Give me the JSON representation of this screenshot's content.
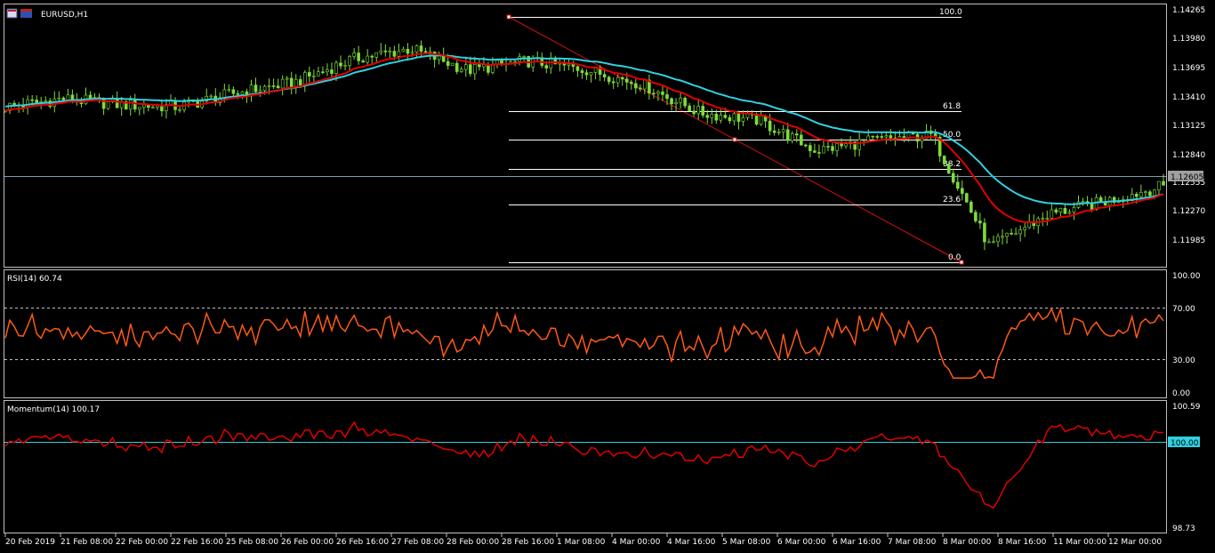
{
  "window": {
    "symbol_title": "EURUSD,H1",
    "icon": "chart-window-icon"
  },
  "colors": {
    "background": "#000000",
    "grid_border": "#c0c0c0",
    "bull_candle": "#7fdc3c",
    "ma_fast": "#e00000",
    "ma_slow": "#30d0e0",
    "rsi_line": "#ff5a14",
    "momentum_line": "#e00000",
    "fib_lines": "#ffffff",
    "fib_trend": "#d01010",
    "price_line": "#70a0b0",
    "reference_line": "#30d0e0"
  },
  "main_panel": {
    "price_ticks": [
      "1.14265",
      "1.13980",
      "1.13695",
      "1.13410",
      "1.13125",
      "1.12840",
      "1.12555",
      "1.12270",
      "1.11985"
    ],
    "current_price": "1.12605",
    "fib_levels": [
      "100.0",
      "61.8",
      "50.0",
      "38.2",
      "23.6",
      "0.0"
    ]
  },
  "rsi_panel": {
    "title": "RSI(14) 60.74",
    "ticks": [
      "100.00",
      "70.00",
      "30.00",
      "0.00"
    ]
  },
  "momentum_panel": {
    "title": "Momentum(14) 100.17",
    "ticks": [
      "100.59",
      "98.73"
    ],
    "reference_value": "100.00"
  },
  "time_axis": {
    "labels": [
      "20 Feb 2019",
      "21 Feb 08:00",
      "22 Feb 00:00",
      "22 Feb 16:00",
      "25 Feb 08:00",
      "26 Feb 00:00",
      "26 Feb 16:00",
      "27 Feb 08:00",
      "28 Feb 00:00",
      "28 Feb 16:00",
      "1 Mar 08:00",
      "4 Mar 00:00",
      "4 Mar 16:00",
      "5 Mar 08:00",
      "6 Mar 00:00",
      "6 Mar 16:00",
      "7 Mar 08:00",
      "8 Mar 00:00",
      "8 Mar 16:00",
      "11 Mar 00:00",
      "12 Mar 00:00"
    ]
  },
  "chart_data": {
    "type": "line",
    "symbol": "EURUSD",
    "timeframe": "H1",
    "price_key_points": [
      {
        "t": "20 Feb 2019",
        "price": 1.1338
      },
      {
        "t": "21 Feb 08:00",
        "price": 1.1346
      },
      {
        "t": "22 Feb 00:00",
        "price": 1.134
      },
      {
        "t": "22 Feb 16:00",
        "price": 1.1338
      },
      {
        "t": "25 Feb 08:00",
        "price": 1.1352
      },
      {
        "t": "26 Feb 00:00",
        "price": 1.1362
      },
      {
        "t": "26 Feb 16:00",
        "price": 1.1385
      },
      {
        "t": "27 Feb 08:00",
        "price": 1.1395
      },
      {
        "t": "28 Feb 00:00",
        "price": 1.1374
      },
      {
        "t": "28 Feb 16:00",
        "price": 1.1383
      },
      {
        "t": "1 Mar 08:00",
        "price": 1.1375
      },
      {
        "t": "4 Mar 00:00",
        "price": 1.136
      },
      {
        "t": "4 Mar 16:00",
        "price": 1.1332
      },
      {
        "t": "5 Mar 08:00",
        "price": 1.1325
      },
      {
        "t": "6 Mar 00:00",
        "price": 1.1295
      },
      {
        "t": "6 Mar 16:00",
        "price": 1.1305
      },
      {
        "t": "7 Mar 08:00",
        "price": 1.131
      },
      {
        "t": "8 Mar 00:00",
        "price": 1.12
      },
      {
        "t": "8 Mar 16:00",
        "price": 1.1232
      },
      {
        "t": "11 Mar 00:00",
        "price": 1.1245
      },
      {
        "t": "12 Mar 00:00",
        "price": 1.126
      }
    ],
    "fibonacci": {
      "high": 1.14265,
      "low": 1.1185,
      "levels": [
        100.0,
        61.8,
        50.0,
        38.2,
        23.6,
        0.0
      ]
    },
    "rsi": {
      "ylim": [
        0,
        100
      ],
      "levels": [
        70,
        30
      ],
      "last": 60.74
    },
    "momentum": {
      "ylim": [
        98.73,
        100.59
      ],
      "reference": 100.0,
      "last": 100.17
    }
  }
}
